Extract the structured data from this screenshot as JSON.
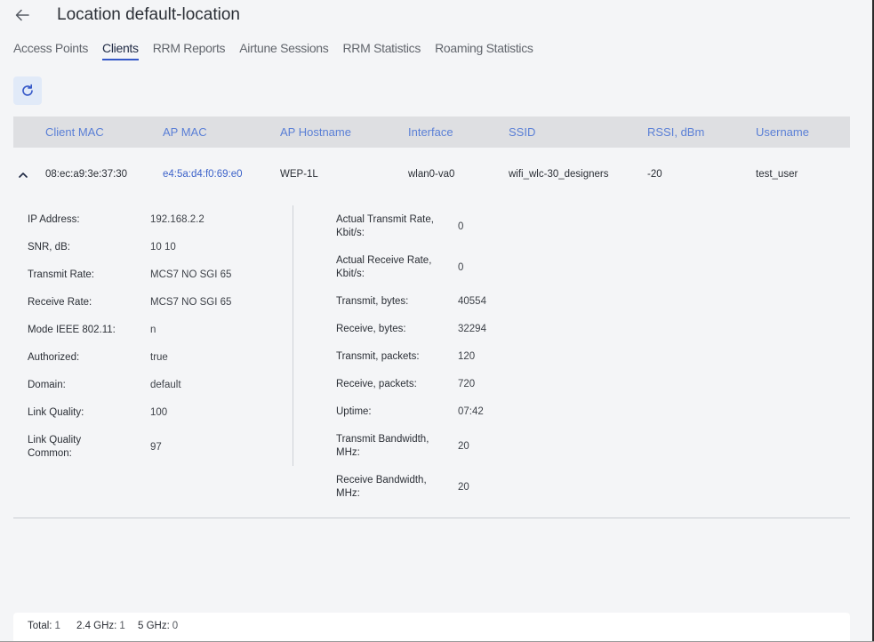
{
  "header": {
    "title": "Location default-location"
  },
  "tabs": [
    {
      "label": "Access Points",
      "active": false
    },
    {
      "label": "Clients",
      "active": true
    },
    {
      "label": "RRM Reports",
      "active": false
    },
    {
      "label": "Airtune Sessions",
      "active": false
    },
    {
      "label": "RRM Statistics",
      "active": false
    },
    {
      "label": "Roaming Statistics",
      "active": false
    }
  ],
  "table": {
    "columns": [
      "Client MAC",
      "AP MAC",
      "AP Hostname",
      "Interface",
      "SSID",
      "RSSI, dBm",
      "Username"
    ],
    "row": {
      "client_mac": "08:ec:a9:3e:37:30",
      "ap_mac": "e4:5a:d4:f0:69:e0",
      "ap_hostname": "WEP-1L",
      "interface": "wlan0-va0",
      "ssid": "wifi_wlc-30_designers",
      "rssi": "-20",
      "username": "test_user"
    }
  },
  "details": {
    "left": [
      {
        "label": "IP Address:",
        "value": "192.168.2.2"
      },
      {
        "label": "SNR, dB:",
        "value": "10 10"
      },
      {
        "label": "Transmit Rate:",
        "value": "MCS7 NO SGI 65"
      },
      {
        "label": "Receive Rate:",
        "value": "MCS7 NO SGI 65"
      },
      {
        "label": "Mode IEEE 802.11:",
        "value": "n"
      },
      {
        "label": "Authorized:",
        "value": "true"
      },
      {
        "label": "Domain:",
        "value": "default"
      },
      {
        "label": "Link Quality:",
        "value": "100"
      },
      {
        "label": "Link Quality Common:",
        "value": "97"
      }
    ],
    "right": [
      {
        "label": "Actual Transmit Rate, Kbit/s:",
        "value": "0"
      },
      {
        "label": "Actual Receive Rate, Kbit/s:",
        "value": "0"
      },
      {
        "label": "Transmit, bytes:",
        "value": "40554"
      },
      {
        "label": "Receive, bytes:",
        "value": "32294"
      },
      {
        "label": "Transmit, packets:",
        "value": "120"
      },
      {
        "label": "Receive, packets:",
        "value": "720"
      },
      {
        "label": "Uptime:",
        "value": "07:42"
      },
      {
        "label": "Transmit Bandwidth, MHz:",
        "value": "20"
      },
      {
        "label": "Receive Bandwidth, MHz:",
        "value": "20"
      }
    ]
  },
  "footer": {
    "total_label": "Total:",
    "total_value": "1",
    "ghz24_label": "2.4 GHz:",
    "ghz24_value": "1",
    "ghz5_label": "5 GHz:",
    "ghz5_value": "0"
  },
  "colors": {
    "accent": "#3558c8",
    "link": "#3c62c9",
    "header_text": "#5a7fd6",
    "table_header_bg": "#dedfe2",
    "page_bg": "#f4f5f7"
  },
  "icons": {
    "back": "arrow-left-icon",
    "refresh": "refresh-icon",
    "collapse": "chevron-up-icon"
  }
}
